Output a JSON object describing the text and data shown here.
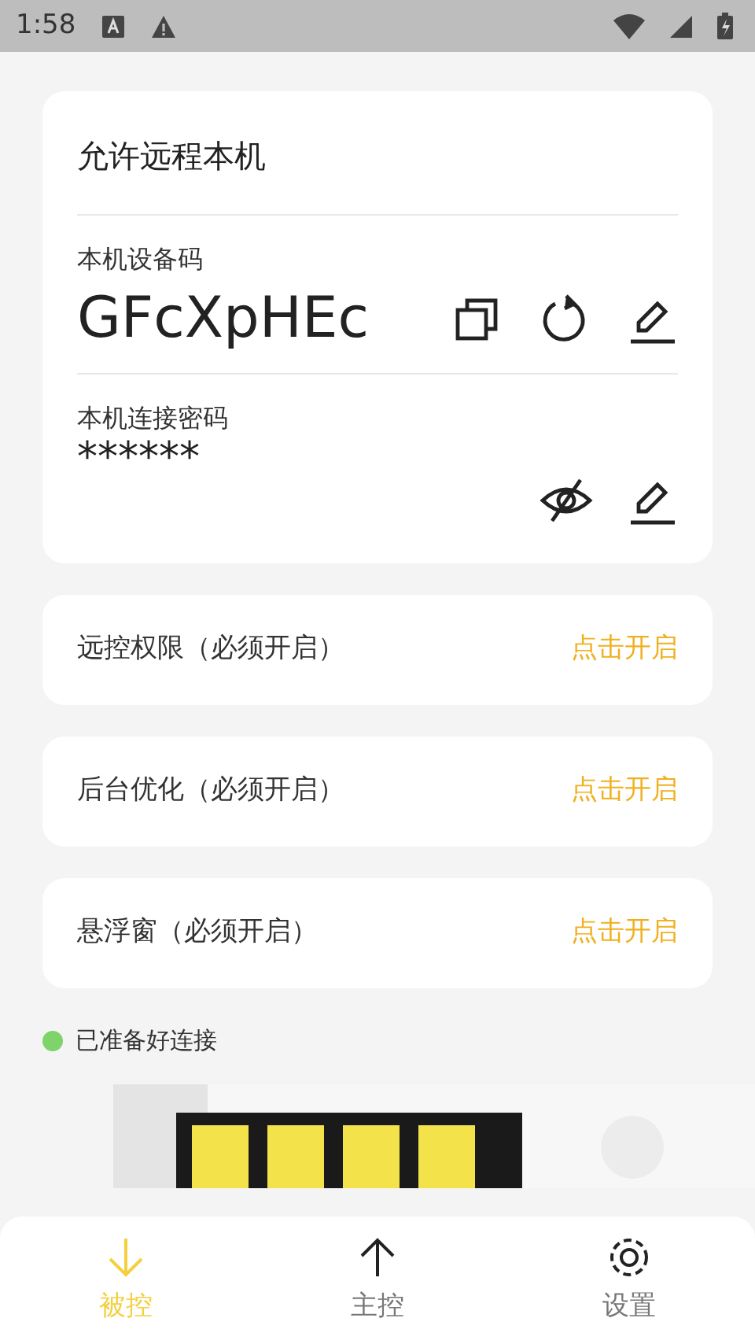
{
  "status_bar": {
    "time": "1:58"
  },
  "remote_card": {
    "title": "允许远程本机",
    "device_code_label": "本机设备码",
    "device_code": "GFcXpHEc",
    "password_label": "本机连接密码",
    "password": "******",
    "password_visible": false
  },
  "permissions": [
    {
      "label": "远控权限（必须开启）",
      "action": "点击开启"
    },
    {
      "label": "后台优化（必须开启）",
      "action": "点击开启"
    },
    {
      "label": "悬浮窗（必须开启）",
      "action": "点击开启"
    }
  ],
  "connection_status": {
    "text": "已准备好连接",
    "color": "#7ed36a"
  },
  "bottom_nav": [
    {
      "label": "被控",
      "kind": "down",
      "selected": true
    },
    {
      "label": "主控",
      "kind": "up",
      "selected": false
    },
    {
      "label": "设置",
      "kind": "gear",
      "selected": false
    }
  ]
}
